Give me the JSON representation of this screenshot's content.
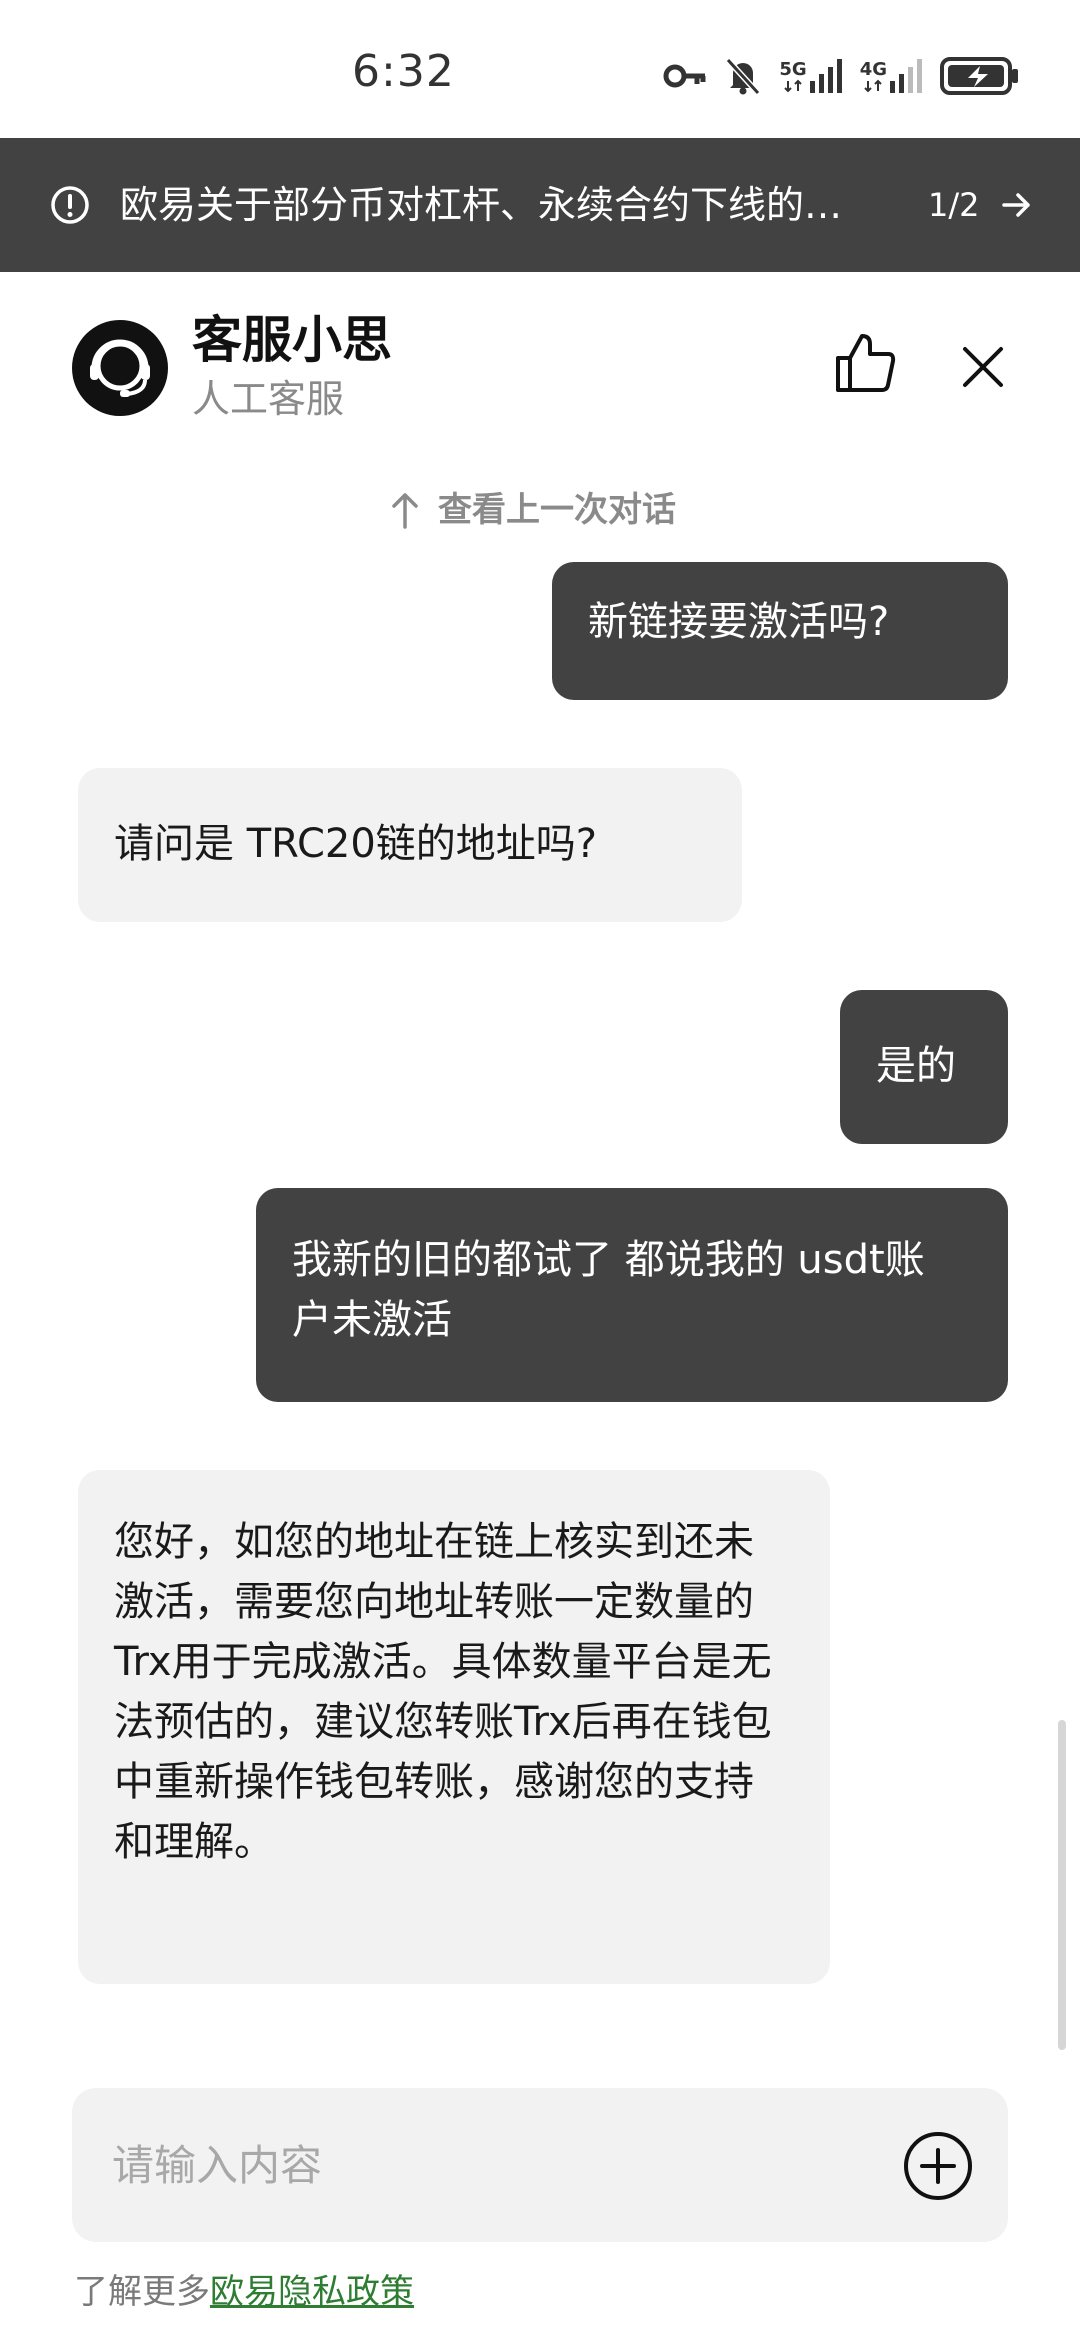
{
  "status_bar": {
    "time": "6:32",
    "icons": [
      "key-icon",
      "mute-bell-icon",
      "signal-5g-icon",
      "signal-4g-icon",
      "battery-charging-icon"
    ],
    "net_1": "5G",
    "net_2": "4G"
  },
  "banner": {
    "icon": "info-circle-icon",
    "text": "欧易关于部分币对杠杆、永续合约下线的…",
    "page": "1/2"
  },
  "header": {
    "agent_name": "客服小思",
    "agent_role": "人工客服"
  },
  "chat": {
    "previous_label": "查看上一次对话",
    "messages": [
      {
        "sender": "user",
        "text": "新链接要激活吗?"
      },
      {
        "sender": "agent",
        "text": "请问是 TRC20链的地址吗?"
      },
      {
        "sender": "user",
        "text": "是的"
      },
      {
        "sender": "user",
        "text": "我新的旧的都试了 都说我的 usdt账户未激活"
      },
      {
        "sender": "agent",
        "text": "您好，如您的地址在链上核实到还未激活，需要您向地址转账一定数量的Trx用于完成激活。具体数量平台是无法预估的，建议您转账Trx后再在钱包中重新操作钱包转账，感谢您的支持和理解。"
      }
    ]
  },
  "input": {
    "placeholder": "请输入内容"
  },
  "footer": {
    "prefix": "了解更多",
    "link": "欧易隐私政策"
  },
  "colors": {
    "banner_bg": "#424242",
    "user_bubble": "#424242",
    "agent_bubble": "#f2f2f2",
    "link": "#2e7d32"
  }
}
